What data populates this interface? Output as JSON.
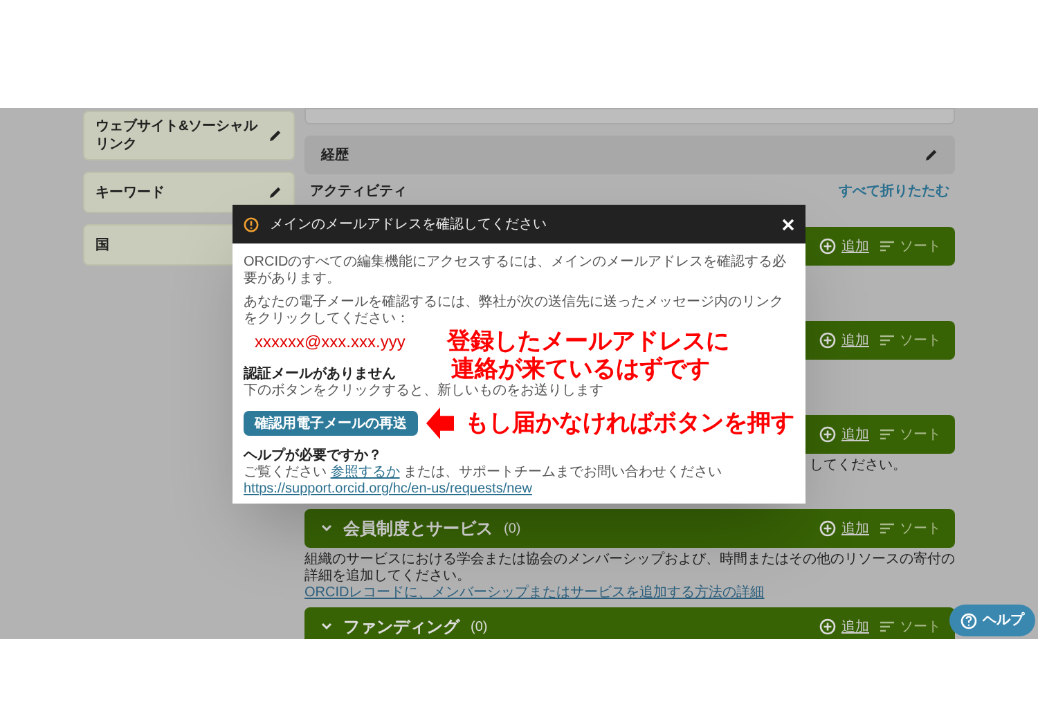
{
  "sidebar": {
    "items": [
      {
        "label": "ウェブサイト&ソーシャルリンク",
        "kind": "edit"
      },
      {
        "label": "キーワード",
        "kind": "edit"
      },
      {
        "label": "国",
        "kind": "plain"
      }
    ]
  },
  "bio_section": {
    "title": "経歴"
  },
  "activities": {
    "heading": "アクティビティ",
    "collapse_link": "すべて折りたたむ"
  },
  "sections": [
    {
      "add_label": "追加",
      "sort_label": "ソート"
    },
    {
      "add_label": "追加",
      "sort_label": "ソート"
    },
    {
      "add_label": "追加",
      "sort_label": "ソート",
      "description": "してください。"
    },
    {
      "title": "会員制度とサービス",
      "count": "(0)",
      "add_label": "追加",
      "sort_label": "ソート",
      "description": "組織のサービスにおける学会または協会のメンバーシップおよび、時間またはその他のリソースの寄付の詳細を追加してください。",
      "link": "ORCIDレコードに、メンバーシップまたはサービスを追加する方法の詳細"
    },
    {
      "title": "ファンディング",
      "count": "(0)",
      "add_label": "追加",
      "sort_label": "ソート"
    }
  ],
  "modal": {
    "title": "メインのメールアドレスを確認してください",
    "intro": "ORCIDのすべての編集機能にアクセスするには、メインのメールアドレスを確認する必要があります。",
    "instruction": "あなたの電子メールを確認するには、弊社が次の送信先に送ったメッセージ内のリンクをクリックしてください：",
    "email": "xxxxxx@xxx.xxx.yyy",
    "no_email_heading": "認証メールがありません",
    "no_email_text": "下のボタンをクリックすると、新しいものをお送りします",
    "resend_button": "確認用電子メールの再送",
    "help_heading": "ヘルプが必要ですか？",
    "help_prefix": "ご覧ください",
    "help_link": "参照するか",
    "help_suffix": "または、サポートチームまでお問い合わせください",
    "help_url": "https://support.orcid.org/hc/en-us/requests/new"
  },
  "annotations": [
    "登録したメールアドレスに",
    "連絡が来ているはずです",
    "もし届かなければボタンを押す"
  ],
  "help_button": {
    "label": "ヘルプ"
  }
}
